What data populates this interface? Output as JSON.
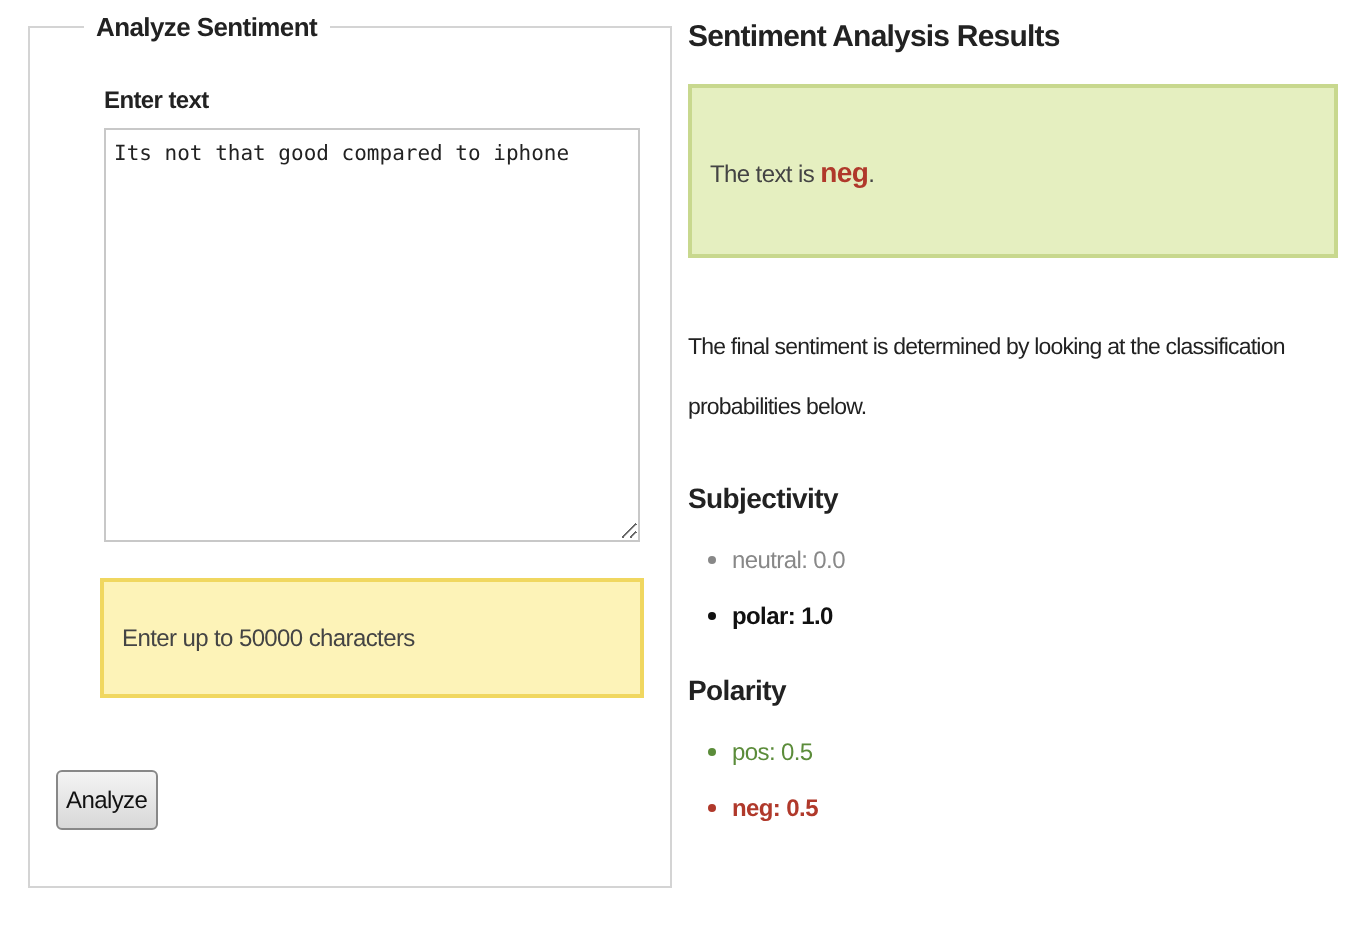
{
  "form": {
    "legend": "Analyze Sentiment",
    "label": "Enter text",
    "value": "Its not that good compared to iphone",
    "hint": "Enter up to 50000 characters",
    "button": "Analyze"
  },
  "results": {
    "title": "Sentiment Analysis Results",
    "verdict": {
      "before": "The text is ",
      "label": "neg",
      "after": ".",
      "color": "#b0392b"
    },
    "description": "The final sentiment is determined by looking at the classification probabilities below.",
    "sections": [
      {
        "title": "Subjectivity",
        "items": [
          {
            "text": "neutral: 0.0",
            "color": "#888888",
            "emphasized": false
          },
          {
            "text": "polar: 1.0",
            "color": "#111111",
            "emphasized": true
          }
        ]
      },
      {
        "title": "Polarity",
        "items": [
          {
            "text": "pos: 0.5",
            "color": "#5b8c3a",
            "emphasized": false
          },
          {
            "text": "neg: 0.5",
            "color": "#b0392b",
            "emphasized": true
          }
        ]
      }
    ]
  }
}
